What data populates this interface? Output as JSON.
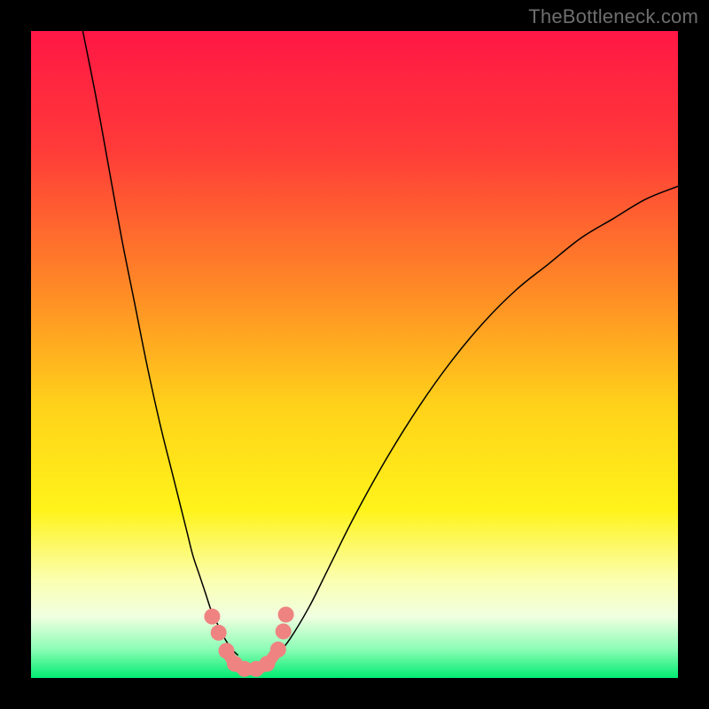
{
  "watermark": "TheBottleneck.com",
  "chart_data": {
    "type": "line",
    "title": "",
    "xlabel": "",
    "ylabel": "",
    "xlim": [
      0,
      100
    ],
    "ylim": [
      0,
      100
    ],
    "background_gradient": {
      "direction": "vertical",
      "stops": [
        {
          "offset": 0.0,
          "color": "#ff1745"
        },
        {
          "offset": 0.18,
          "color": "#ff3a39"
        },
        {
          "offset": 0.4,
          "color": "#ff8a26"
        },
        {
          "offset": 0.58,
          "color": "#ffd21a"
        },
        {
          "offset": 0.74,
          "color": "#fff31a"
        },
        {
          "offset": 0.85,
          "color": "#fbffb2"
        },
        {
          "offset": 0.905,
          "color": "#f0ffe0"
        },
        {
          "offset": 0.955,
          "color": "#8dfdb6"
        },
        {
          "offset": 1.0,
          "color": "#01ec71"
        }
      ]
    },
    "series": [
      {
        "name": "left-curve",
        "color": "#000000",
        "width": 1.5,
        "x": [
          8,
          10,
          12,
          14,
          16,
          18,
          20,
          22,
          24,
          25,
          26,
          27,
          28,
          29,
          30,
          31,
          32
        ],
        "y": [
          100,
          90,
          79,
          68,
          58,
          48,
          39,
          31,
          23,
          19,
          16,
          13,
          10,
          8,
          6,
          4.5,
          3.5
        ]
      },
      {
        "name": "right-curve",
        "color": "#000000",
        "width": 1.5,
        "x": [
          38,
          40,
          43,
          46,
          50,
          55,
          60,
          65,
          70,
          75,
          80,
          85,
          90,
          95,
          100
        ],
        "y": [
          3.5,
          6,
          11,
          17,
          25,
          34,
          42,
          49,
          55,
          60,
          64,
          68,
          71,
          74,
          76
        ]
      },
      {
        "name": "bottleneck-markers",
        "type": "scatter",
        "marker_color": "#ef8381",
        "marker_radius_px": 9,
        "x": [
          28.0,
          29.0,
          30.2,
          31.5,
          33.0,
          34.8,
          36.5,
          38.2,
          39.0,
          39.4
        ],
        "y": [
          9.5,
          7.0,
          4.2,
          2.2,
          1.4,
          1.4,
          2.2,
          4.4,
          7.2,
          9.8
        ]
      },
      {
        "name": "bottleneck-connector",
        "color": "#ef8381",
        "width": 13,
        "x": [
          30.2,
          31.5,
          33.0,
          34.8,
          36.5,
          38.2
        ],
        "y": [
          4.2,
          2.2,
          1.4,
          1.4,
          2.2,
          4.4
        ]
      }
    ]
  }
}
